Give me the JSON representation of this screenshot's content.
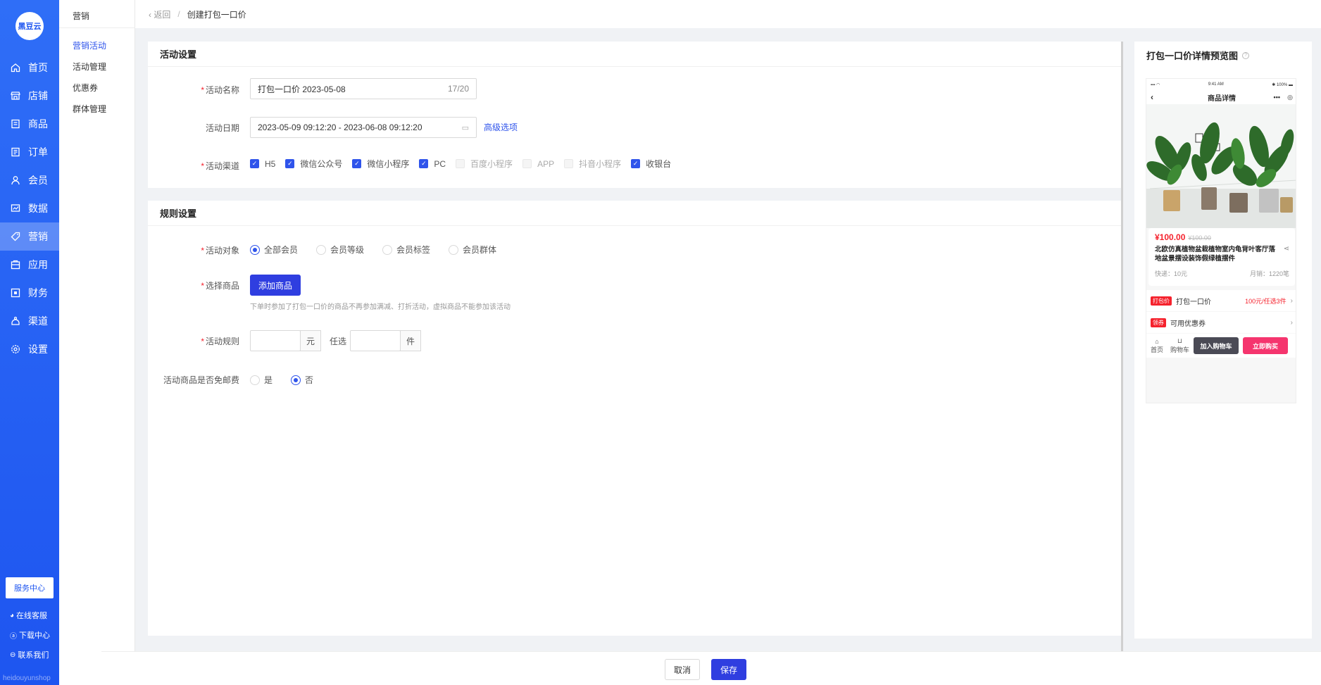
{
  "app": {
    "logo": "黑豆云",
    "watermark": "heidouyunshop"
  },
  "sidebar": {
    "items": [
      {
        "label": "首页",
        "icon": "home-icon"
      },
      {
        "label": "店铺",
        "icon": "store-icon"
      },
      {
        "label": "商品",
        "icon": "product-icon"
      },
      {
        "label": "订单",
        "icon": "order-icon"
      },
      {
        "label": "会员",
        "icon": "member-icon"
      },
      {
        "label": "数据",
        "icon": "data-icon"
      },
      {
        "label": "营销",
        "icon": "tag-icon"
      },
      {
        "label": "应用",
        "icon": "app-icon"
      },
      {
        "label": "财务",
        "icon": "finance-icon"
      },
      {
        "label": "渠道",
        "icon": "channel-icon"
      },
      {
        "label": "设置",
        "icon": "gear-icon"
      }
    ],
    "service_center": "服务中心",
    "online_service": "在线客服",
    "download_center": "下载中心",
    "contact_us": "联系我们"
  },
  "subnav": {
    "title": "营销",
    "items": [
      "营销活动",
      "活动管理",
      "优惠券",
      "群体管理"
    ]
  },
  "topbar": {
    "back": "返回",
    "separator": "/",
    "current": "创建打包一口价"
  },
  "activity_settings": {
    "title": "活动设置",
    "name_label": "活动名称",
    "name_value": "打包一口价  2023-05-08",
    "name_count": "17/20",
    "date_label": "活动日期",
    "date_value": "2023-05-09 09:12:20 - 2023-06-08 09:12:20",
    "advanced": "高级选项",
    "channel_label": "活动渠道",
    "channels": [
      {
        "label": "H5",
        "state": "on"
      },
      {
        "label": "微信公众号",
        "state": "on"
      },
      {
        "label": "微信小程序",
        "state": "on"
      },
      {
        "label": "PC",
        "state": "on"
      },
      {
        "label": "百度小程序",
        "state": "dis"
      },
      {
        "label": "APP",
        "state": "dis"
      },
      {
        "label": "抖音小程序",
        "state": "dis"
      },
      {
        "label": "收银台",
        "state": "on"
      }
    ]
  },
  "rule_settings": {
    "title": "规则设置",
    "target_label": "活动对象",
    "targets": [
      {
        "label": "全部会员",
        "on": true
      },
      {
        "label": "会员等级",
        "on": false
      },
      {
        "label": "会员标签",
        "on": false
      },
      {
        "label": "会员群体",
        "on": false
      }
    ],
    "goods_label": "选择商品",
    "add_goods": "添加商品",
    "goods_hint": "下单时参加了打包一口价的商品不再参加满减、打折活动，虚拟商品不能参加该活动",
    "rule_label": "活动规则",
    "unit_yuan": "元",
    "any_choose": "任选",
    "unit_piece": "件",
    "free_ship_label": "活动商品是否免邮费",
    "free_ship": [
      {
        "label": "是",
        "on": false
      },
      {
        "label": "否",
        "on": true
      }
    ]
  },
  "preview": {
    "title": "打包一口价详情预览图",
    "help": "?",
    "status_time": "9:41 AM",
    "status_battery": "100%",
    "nav_title": "商品详情",
    "price": "¥100.00",
    "orig_price": "¥100.00",
    "product_name": "北欧仿真植物盆栽植物室内龟背叶客厅落地盆景摆设装饰假绿植摆件",
    "shipping": "快递：10元",
    "sales": "月销：1220笔",
    "bundle_tag": "打包价",
    "bundle_label": "打包一口价",
    "bundle_value": "100元/任选3件",
    "coupon_tag": "领券",
    "coupon_label": "可用优惠券",
    "home": "首页",
    "cart": "购物车",
    "add_cart": "加入购物车",
    "buy_now": "立即购买"
  },
  "footer": {
    "cancel": "取消",
    "save": "保存"
  },
  "colors": {
    "primary": "#2f3ee0",
    "sidebar": "#1e55f0",
    "price": "#f5222d",
    "buy": "#f5356e",
    "cart_btn": "#4a4a55"
  }
}
